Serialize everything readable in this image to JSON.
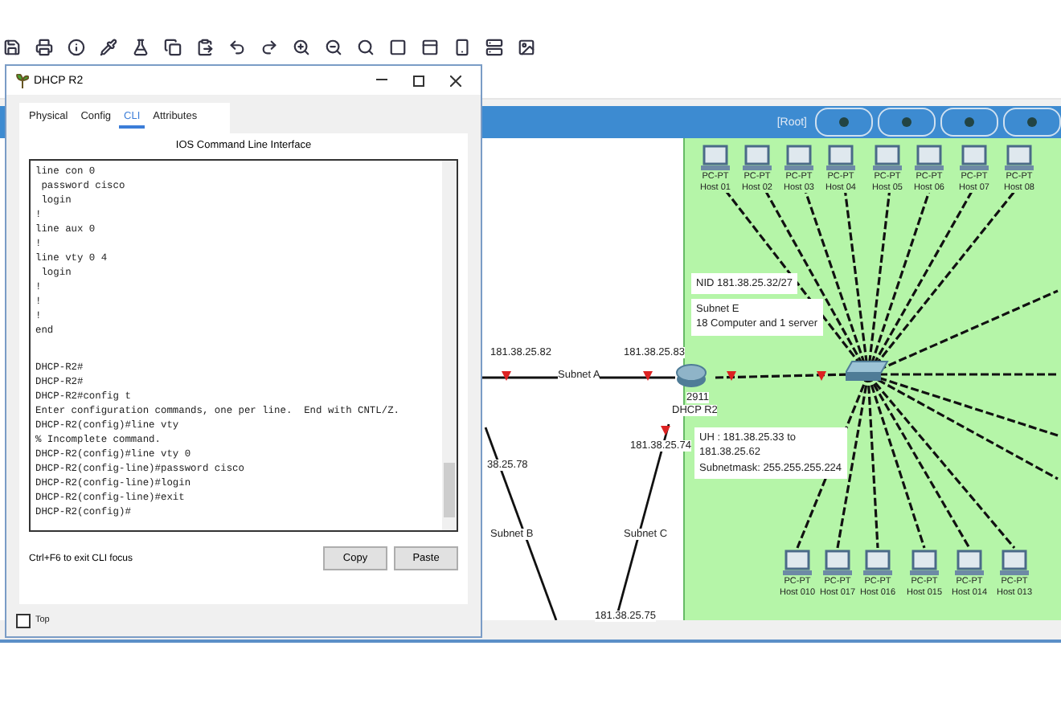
{
  "dialog": {
    "title": "DHCP R2",
    "tabs": [
      {
        "label": "Physical",
        "selected": false
      },
      {
        "label": "Config",
        "selected": false
      },
      {
        "label": "CLI",
        "selected": true
      },
      {
        "label": "Attributes",
        "selected": false
      }
    ],
    "heading": "IOS Command Line Interface",
    "config_lines": [
      "line con 0",
      " password cisco",
      " login",
      "!",
      "line aux 0",
      "!",
      "line vty 0 4",
      " login",
      "!",
      "!",
      "!",
      "end"
    ],
    "session_lines": [
      "DHCP-R2#",
      "DHCP-R2#",
      "DHCP-R2#config t",
      "Enter configuration commands, one per line.  End with CNTL/Z.",
      "DHCP-R2(config)#line vty",
      "% Incomplete command.",
      "DHCP-R2(config)#line vty 0",
      "DHCP-R2(config-line)#password cisco",
      "DHCP-R2(config-line)#login",
      "DHCP-R2(config-line)#exit",
      "DHCP-R2(config)#"
    ],
    "hint": "Ctrl+F6 to exit CLI focus",
    "buttons": [
      "Copy",
      "Paste"
    ],
    "top_checkbox": {
      "label": "Top",
      "checked": false
    }
  },
  "workspace": {
    "root_label": "[Root]",
    "hosts_top": [
      {
        "type": "PC-PT",
        "name": "Host 01"
      },
      {
        "type": "PC-PT",
        "name": "Host 02"
      },
      {
        "type": "PC-PT",
        "name": "Host 03"
      },
      {
        "type": "PC-PT",
        "name": "Host 04"
      },
      {
        "type": "PC-PT",
        "name": "Host 05"
      },
      {
        "type": "PC-PT",
        "name": "Host 06"
      },
      {
        "type": "PC-PT",
        "name": "Host 07"
      },
      {
        "type": "PC-PT",
        "name": "Host 08"
      }
    ],
    "hosts_bottom": [
      {
        "type": "PC-PT",
        "name": "Host 010"
      },
      {
        "type": "PC-PT",
        "name": "Host 017"
      },
      {
        "type": "PC-PT",
        "name": "Host 016"
      },
      {
        "type": "PC-PT",
        "name": "Host 015"
      },
      {
        "type": "PC-PT",
        "name": "Host 014"
      },
      {
        "type": "PC-PT",
        "name": "Host 013"
      }
    ],
    "router": {
      "model": "2911",
      "name": "DHCP R2"
    },
    "link_labels": [
      "181.38.25.82",
      "181.38.25.83",
      "Subnet A",
      "181.38.25.74",
      "38.25.78",
      "Subnet B",
      "Subnet C",
      "181.38.25.75"
    ],
    "notes": [
      [
        "NID 181.38.25.32/27"
      ],
      [
        "Subnet E",
        "18 Computer and 1 server"
      ],
      [
        "UH : 181.38.25.33 to",
        "181.38.25.62",
        "Subnetmask: 255.255.255.224"
      ]
    ]
  }
}
